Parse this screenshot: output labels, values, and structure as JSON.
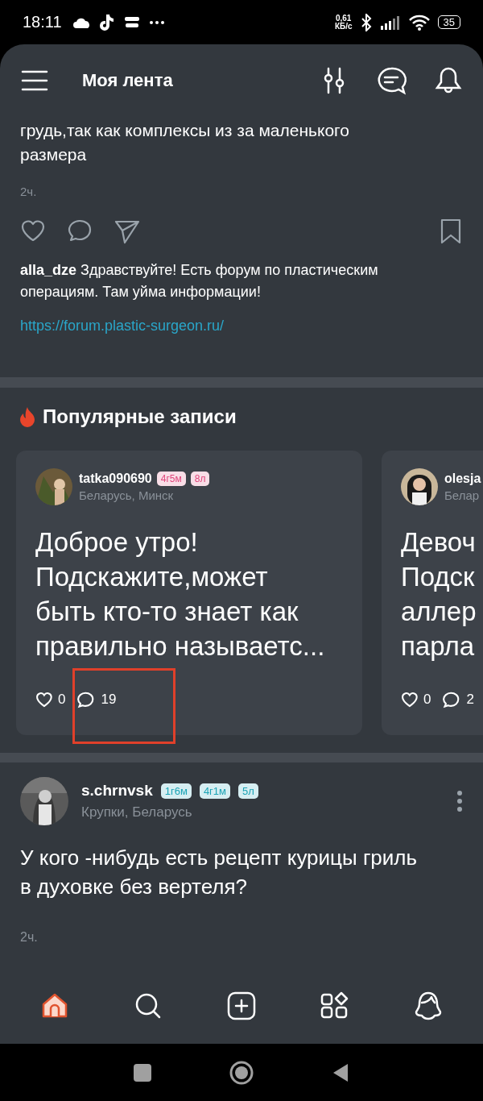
{
  "status_bar": {
    "time": "18:11",
    "net_speed": "0,61",
    "net_unit": "КБ/с",
    "battery": "35"
  },
  "header": {
    "title": "Моя лента"
  },
  "post": {
    "text": "грудь,так как комплексы из за маленького размера",
    "time": "2ч.",
    "comment": {
      "author": "alla_dze",
      "text": "Здравствуйте! Есть форум по пластическим операциям. Там уйма информации!"
    },
    "link": "https://forum.plastic-surgeon.ru/"
  },
  "popular": {
    "title": "Популярные записи",
    "cards": [
      {
        "author": "tatka090690",
        "badges": [
          {
            "label": "4г5м",
            "color": "#e0457b"
          },
          {
            "label": "8л",
            "color": "#e0457b"
          }
        ],
        "location": "Беларусь, Минск",
        "lines": [
          "Доброе утро!",
          "Подскажите,может",
          "быть кто-то знает как",
          "правильно называетс..."
        ],
        "likes": "0",
        "comments": "19",
        "highlighted": true
      },
      {
        "author": "olesja",
        "location": "Белар",
        "lines": [
          "Девоч",
          "Подск",
          "аллер",
          "парла"
        ],
        "likes": "0",
        "comments": "2",
        "highlighted": false
      }
    ]
  },
  "feed_post": {
    "author": "s.chrnvsk",
    "badges": [
      {
        "label": "1г6м",
        "color": "#1aa3b5"
      },
      {
        "label": "4г1м",
        "color": "#1aa3b5"
      },
      {
        "label": "5л",
        "color": "#1aa3b5"
      }
    ],
    "location": "Крупки, Беларусь",
    "text": "У кого -нибудь есть рецепт курицы гриль в духовке без вертеля?",
    "time": "2ч."
  },
  "bottom_nav": [
    {
      "kind": "home",
      "selected": true
    },
    {
      "kind": "search",
      "selected": false
    },
    {
      "kind": "add",
      "selected": false
    },
    {
      "kind": "services",
      "selected": false
    },
    {
      "kind": "profile",
      "selected": false
    }
  ]
}
